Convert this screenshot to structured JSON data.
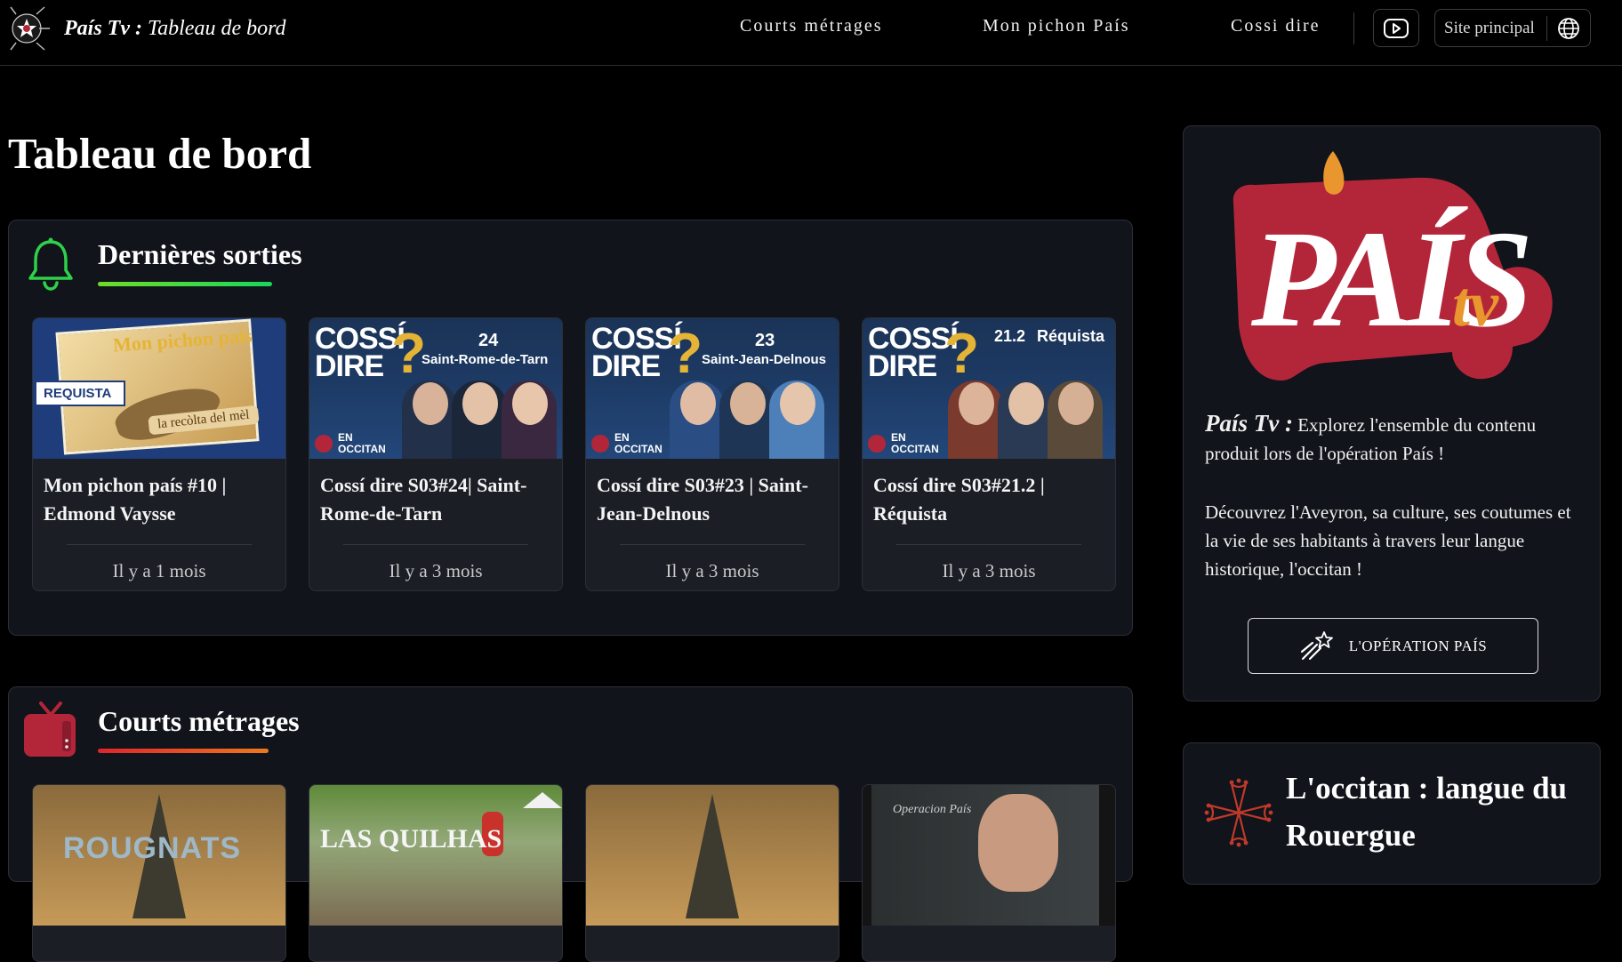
{
  "header": {
    "brand_name": "País Tv :",
    "brand_sub": "Tableau de bord",
    "nav": [
      "Courts métrages",
      "Mon pichon País",
      "Cossi dire"
    ],
    "site_button_label": "Site principal",
    "youtube_icon": "youtube-icon",
    "globe_icon": "globe-icon"
  },
  "page": {
    "title": "Tableau de bord"
  },
  "latest": {
    "title": "Dernières sorties",
    "icon": "bell-icon",
    "underline_color": "#2fd04a",
    "cards": [
      {
        "title": "Mon pichon país #10 | Edmond Vaysse",
        "date": "Il y a 1 mois",
        "thumb_title": "Mon pichon país",
        "thumb_tag": "REQUISTA",
        "thumb_caption": "la recòlta del mèl"
      },
      {
        "title": "Cossí dire S03#24| Saint-Rome-de-Tarn",
        "date": "Il y a 3 mois",
        "thumb_brand": "COSSÍ DIRE",
        "thumb_num": "24",
        "thumb_place": "Saint-Rome-de-Tarn",
        "thumb_lang": "EN OCCITAN"
      },
      {
        "title": "Cossí dire S03#23 | Saint-Jean-Delnous",
        "date": "Il y a 3 mois",
        "thumb_brand": "COSSÍ DIRE",
        "thumb_num": "23",
        "thumb_place": "Saint-Jean-Delnous",
        "thumb_lang": "EN OCCITAN"
      },
      {
        "title": "Cossí dire S03#21.2 | Réquista",
        "date": "Il y a 3 mois",
        "thumb_brand": "COSSÍ DIRE",
        "thumb_num": "21.2",
        "thumb_place": "Réquista",
        "thumb_lang": "EN OCCITAN"
      }
    ]
  },
  "shorts": {
    "title": "Courts métrages",
    "icon": "tv-icon",
    "underline_color": "#e0402a",
    "thumbs": [
      {
        "caption": "ROUGNATS"
      },
      {
        "caption": "LAS QUILHAS"
      },
      {
        "caption": ""
      },
      {
        "caption": "Operacion País"
      }
    ]
  },
  "sidebar": {
    "logo_text": "PAÍS",
    "logo_tv": "tv",
    "intro_brand": "País Tv :",
    "intro_text": "Explorez l'ensemble du contenu produit lors de l'opération País !",
    "body_text": "Découvrez l'Aveyron, sa culture, ses coutumes et la vie de ses habitants à travers leur langue historique, l'occitan !",
    "button_label": "L'OPÉRATION PAÍS",
    "button_icon": "shooting-star-icon",
    "occitan_title": "L'occitan : langue du Rouergue",
    "occitan_icon": "occitan-cross-icon"
  },
  "colors": {
    "background": "#000000",
    "panel": "#11141a",
    "card": "#1b1e25",
    "gold": "#e5b437",
    "brand_red": "#b3263a",
    "brand_orange": "#e8962d"
  }
}
